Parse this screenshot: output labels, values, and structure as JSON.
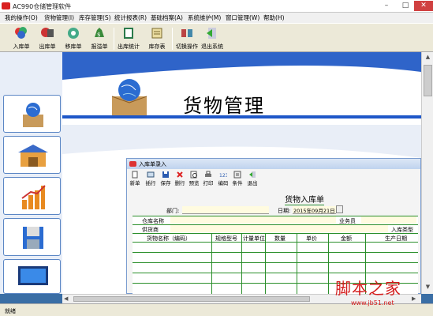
{
  "window": {
    "title": "AC990仓储管理软件"
  },
  "menu": [
    "我的操作(O)",
    "货物管理(I)",
    "库存管理(S)",
    "统计报表(R)",
    "基础档案(A)",
    "系统维护(M)",
    "窗口管理(W)",
    "帮助(H)"
  ],
  "toolbar": [
    "入库单",
    "出库单",
    "移库单",
    "报溢单",
    "出库统计",
    "库存表",
    "切换操作",
    "退出系统"
  ],
  "banner": {
    "title": "货物管理"
  },
  "child": {
    "title": "入库单录入",
    "toolbar": [
      "新单",
      "插行",
      "保存",
      "删行",
      "预览",
      "打印",
      "编码",
      "条件",
      "退出"
    ],
    "form_title": "货物入库单",
    "dept_label": "部门:",
    "date_label": "日期:",
    "date_value": "2015年09月21日",
    "warehouse_label": "仓库名称",
    "clerk_label": "业务员",
    "supplier_label": "供货商",
    "type_label": "入库类型",
    "columns": [
      "货物名称（编码）",
      "规格型号",
      "计量单位",
      "数量",
      "单价",
      "金额",
      "生产日期"
    ]
  },
  "status": {
    "text": "就绪"
  },
  "watermark": {
    "title": "脚本之家",
    "url": "www.jb51.net"
  }
}
